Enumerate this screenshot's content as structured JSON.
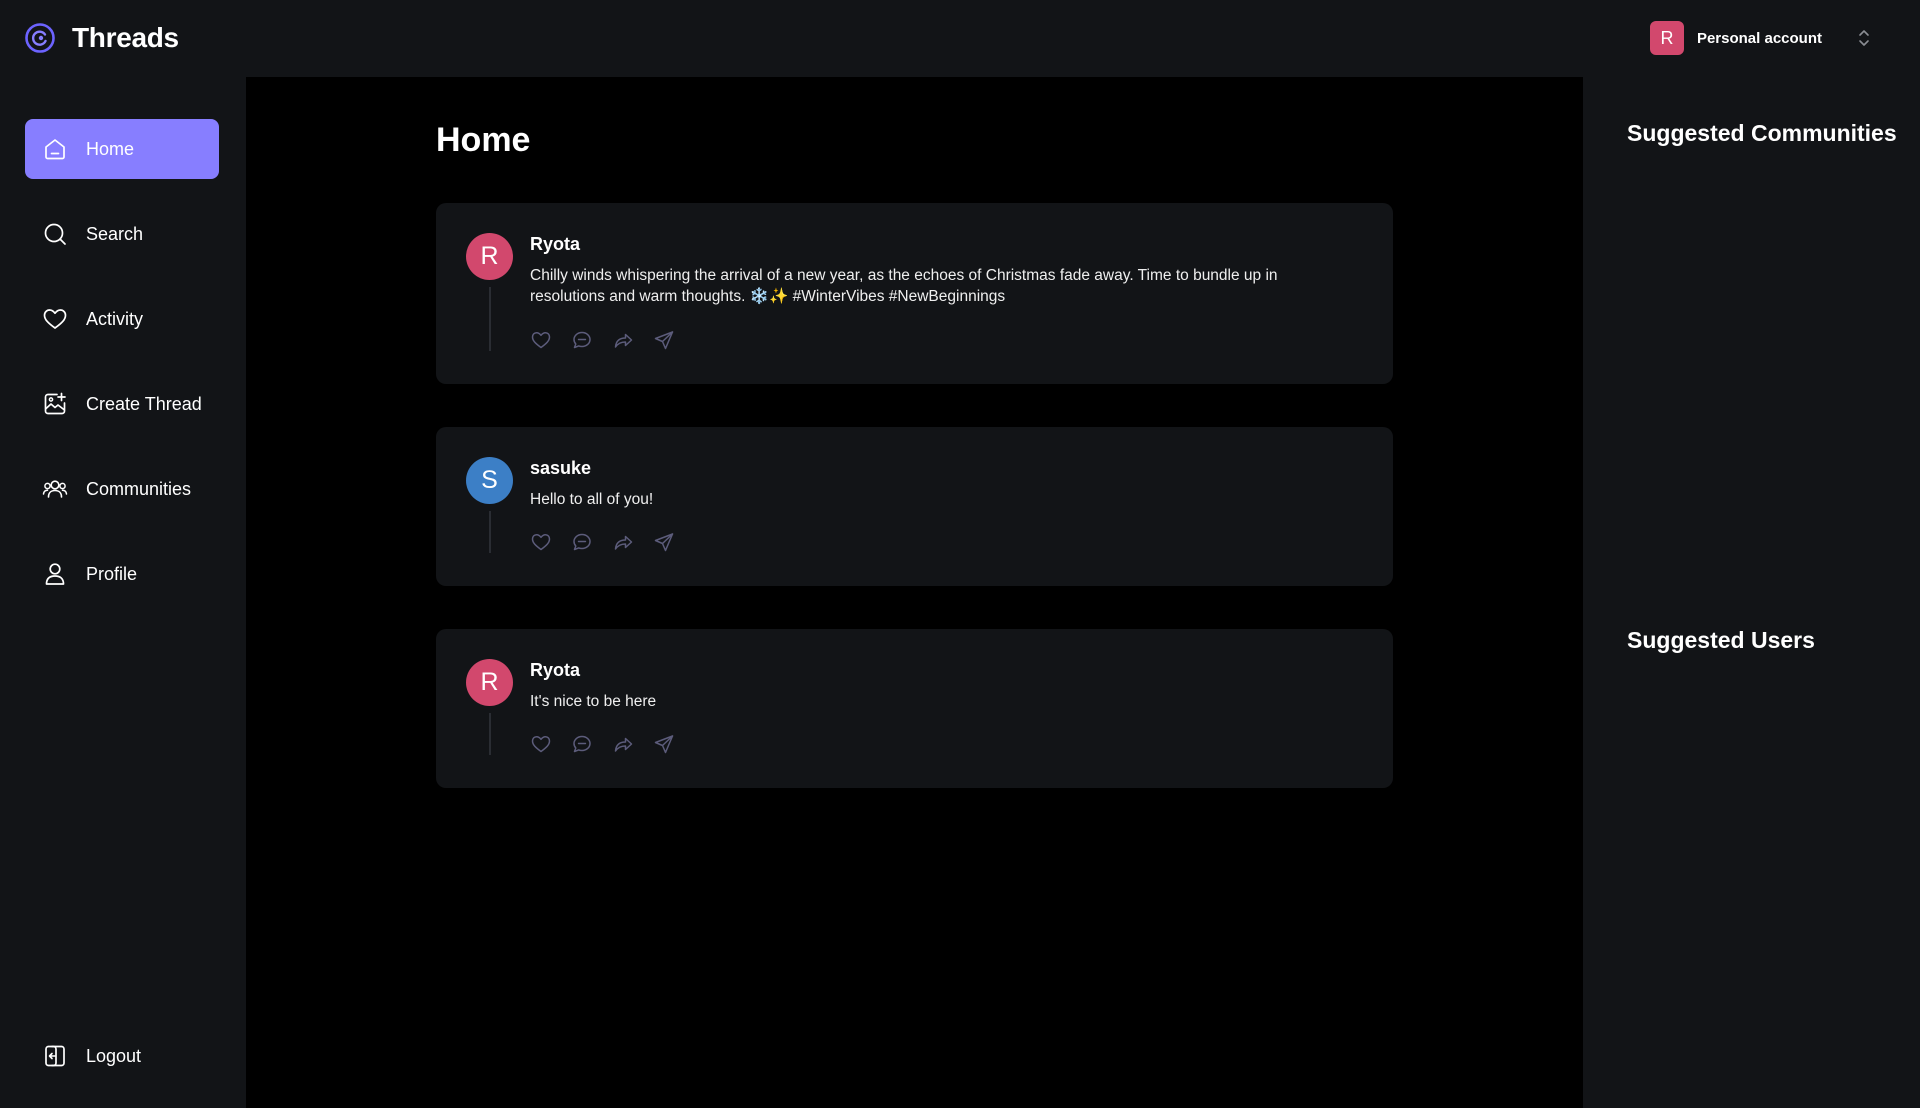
{
  "brand": {
    "name": "Threads"
  },
  "account": {
    "avatar_letter": "R",
    "label": "Personal account"
  },
  "sidebar": {
    "items": [
      {
        "label": "Home",
        "icon": "home-icon",
        "active": true
      },
      {
        "label": "Search",
        "icon": "search-icon"
      },
      {
        "label": "Activity",
        "icon": "heart-icon"
      },
      {
        "label": "Create Thread",
        "icon": "create-thread-icon"
      },
      {
        "label": "Communities",
        "icon": "communities-icon"
      },
      {
        "label": "Profile",
        "icon": "profile-icon"
      }
    ],
    "logout": {
      "label": "Logout",
      "icon": "logout-icon"
    }
  },
  "main": {
    "title": "Home",
    "threads": [
      {
        "author": "Ryota",
        "avatar_letter": "R",
        "avatar_color": "#d2486d",
        "content": "Chilly winds whispering the arrival of a new year, as the echoes of Christmas fade away. Time to bundle up in resolutions and warm thoughts. ❄️✨ #WinterVibes #NewBeginnings"
      },
      {
        "author": "sasuke",
        "avatar_letter": "S",
        "avatar_color": "#3c7fc6",
        "content": "Hello to all of you!"
      },
      {
        "author": "Ryota",
        "avatar_letter": "R",
        "avatar_color": "#d2486d",
        "content": "It's nice to be here"
      }
    ]
  },
  "rightbar": {
    "suggested_communities": "Suggested Communities",
    "suggested_users": "Suggested Users"
  },
  "colors": {
    "accent": "#877eff",
    "panel": "#121417",
    "background": "#000000"
  }
}
